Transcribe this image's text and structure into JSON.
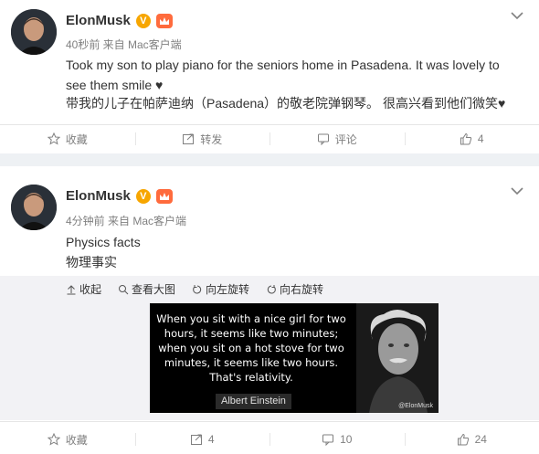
{
  "posts": [
    {
      "author": "ElonMusk",
      "verified_mark": "V",
      "meta": "40秒前 来自 Mac客户端",
      "text_en": "Took my son to play piano for the seniors home in Pasadena. It was lovely to see them smile ♥",
      "text_zh": "带我的儿子在帕萨迪纳（Pasadena）的敬老院弹钢琴。 很高兴看到他们微笑♥",
      "actions": {
        "favorite": "收藏",
        "repost": "转发",
        "comment": "评论",
        "like": "4"
      }
    },
    {
      "author": "ElonMusk",
      "verified_mark": "V",
      "meta": "4分钟前 来自 Mac客户端",
      "text_en": "Physics facts",
      "text_zh": "物理事实",
      "media_tools": {
        "collapse": "收起",
        "view_large": "查看大图",
        "rotate_left": "向左旋转",
        "rotate_right": "向右旋转"
      },
      "image": {
        "quote": "When you sit with a nice girl for two hours, it seems like two minutes; when you sit on a hot stove for two minutes, it seems like two hours. That's relativity.",
        "attribution": "Albert Einstein",
        "watermark": "@ElonMusk"
      },
      "actions": {
        "favorite": "收藏",
        "repost": "4",
        "comment": "10",
        "like": "24"
      }
    }
  ],
  "colors": {
    "badge": "#f7a600",
    "meta": "#808080",
    "panel": "#f2f2f5"
  }
}
